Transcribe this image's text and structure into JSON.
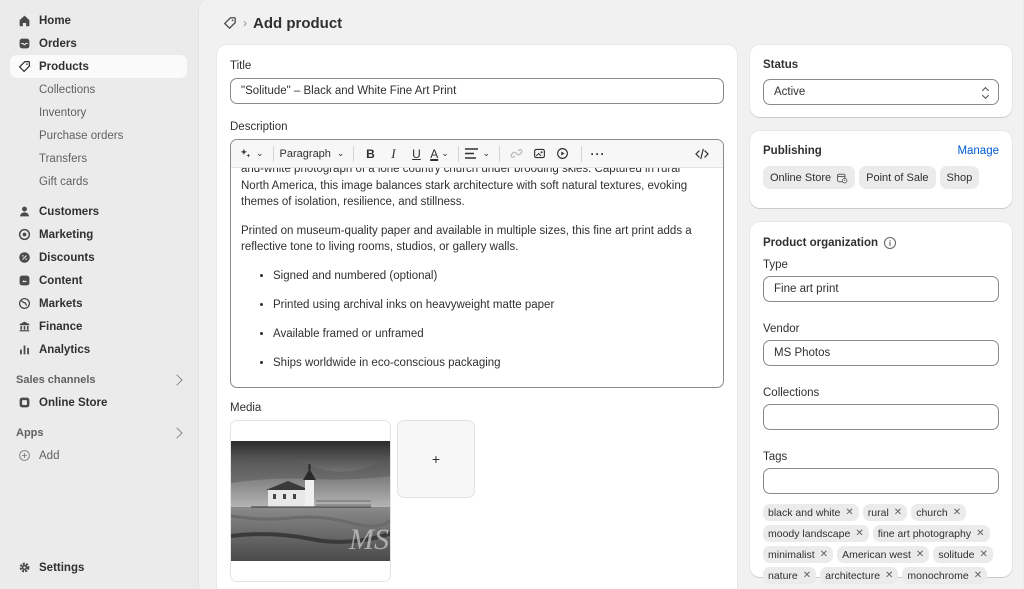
{
  "sidebar": {
    "items": [
      {
        "label": "Home",
        "icon": "home-icon"
      },
      {
        "label": "Orders",
        "icon": "inbox-icon"
      },
      {
        "label": "Products",
        "icon": "tag-icon"
      }
    ],
    "product_sub": [
      "Collections",
      "Inventory",
      "Purchase orders",
      "Transfers",
      "Gift cards"
    ],
    "items2": [
      {
        "label": "Customers",
        "icon": "person-icon"
      },
      {
        "label": "Marketing",
        "icon": "target-icon"
      },
      {
        "label": "Discounts",
        "icon": "discount-icon"
      },
      {
        "label": "Content",
        "icon": "content-icon"
      },
      {
        "label": "Markets",
        "icon": "globe-icon"
      },
      {
        "label": "Finance",
        "icon": "bank-icon"
      },
      {
        "label": "Analytics",
        "icon": "bar-chart-icon"
      }
    ],
    "sales_channels_label": "Sales channels",
    "online_store": "Online Store",
    "apps_label": "Apps",
    "add_label": "Add",
    "settings_label": "Settings"
  },
  "header": {
    "title": "Add product",
    "separator": "›"
  },
  "form": {
    "title_label": "Title",
    "title_value": "\"Solitude\" – Black and White Fine Art Print",
    "description_label": "Description",
    "toolbar": {
      "paragraph": "Paragraph"
    },
    "description": {
      "p1_line1": "and-white photograph of a lone country church under brooding skies. Captured in rural",
      "p1_rest": "North America, this image balances stark architecture with soft natural textures, evoking themes of isolation, resilience, and stillness.",
      "p2": "Printed on museum-quality paper and available in multiple sizes, this fine art print adds a reflective tone to living rooms, studios, or gallery walls.",
      "bullets": [
        "Signed and numbered (optional)",
        "Printed using archival inks on heavyweight matte paper",
        "Available framed or unframed",
        "Ships worldwide in eco-conscious packaging"
      ]
    },
    "media_label": "Media",
    "media_add": "+"
  },
  "status": {
    "label": "Status",
    "value": "Active"
  },
  "publishing": {
    "label": "Publishing",
    "manage": "Manage",
    "channels": [
      "Online Store",
      "Point of Sale",
      "Shop"
    ]
  },
  "organization": {
    "label": "Product organization",
    "type_label": "Type",
    "type_value": "Fine art print",
    "vendor_label": "Vendor",
    "vendor_value": "MS Photos",
    "collections_label": "Collections",
    "collections_value": "",
    "tags_label": "Tags",
    "tags_value": "",
    "tags": [
      "black and white",
      "rural",
      "church",
      "moody landscape",
      "fine art photography",
      "minimalist",
      "American west",
      "solitude",
      "nature",
      "architecture",
      "monochrome"
    ]
  },
  "colors": {
    "accent": "#005bd3",
    "sidebar_bg": "#ebebeb",
    "main_bg": "#f1f1f1"
  }
}
